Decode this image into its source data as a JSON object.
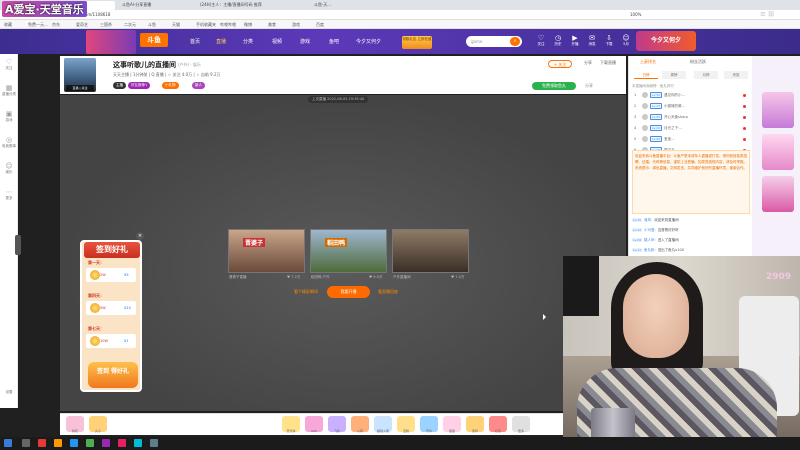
{
  "overlay_title": "A爱宝·天堂音乐",
  "browser": {
    "tabs": [
      "斗鱼(TV)-分享...",
      "斗鱼Al-分享直播",
      "(24H)主人：主播/直播间号码 推荐",
      "斗鱼·天..."
    ],
    "url": "http://www.douyu.com/1108618",
    "bookmarks": [
      "收藏",
      "免费一元...",
      "京东",
      "爱奇艺",
      "三国杀",
      "二次元",
      "斗鱼",
      "天猫",
      "手机收藏夹",
      "哔哩哔哩",
      "微博",
      "美食",
      "游戏",
      "百度"
    ],
    "zoom": "100%"
  },
  "site": {
    "logo": "斗鱼",
    "nav": [
      "首页",
      "直播",
      "分类",
      "视频",
      "游戏",
      "鱼吧",
      "今夕又何夕"
    ],
    "promo": "领取礼包 立即充值",
    "search_placeholder": "game",
    "header_icons": [
      "关注",
      "历史",
      "开播",
      "消息",
      "下载",
      "5月"
    ],
    "banner_text": "今夕又何夕"
  },
  "left_sidebar": [
    "关注",
    "直播分类",
    "游戏",
    "电竞赛事",
    "娱乐",
    "更多"
  ],
  "left_sidebar_bottom": "设置",
  "room": {
    "title": "这事听歌儿的直播间",
    "sub": "(户外) · 娱乐",
    "line2": "天天主播  |  1分钟前  |  Q 直播  |  ☆ 关注 4.0万  |  ☆ 自助 9.2万",
    "tags": [
      "主播",
      "好友推荐1",
      "小礼物",
      "新人"
    ],
    "follow": "+ 关注",
    "actions": [
      "分享",
      "下载直播"
    ],
    "green_btn": "免费领取鱼丸",
    "share": "分享"
  },
  "player": {
    "last_live": "上次直播 2022-08-05 19:35:40",
    "recs": [
      {
        "badge": "晋婆子",
        "caption": "晋婆子直播"
      },
      {
        "badge": "稻田鸭",
        "caption": "稻田鸭 户外"
      },
      {
        "badge": "",
        "caption": "户外直播间"
      }
    ],
    "rec_meta": [
      "♥ 7.2万",
      "♥ 9.0万",
      "♥ 7.0万"
    ],
    "links": [
      "看个精彩瞬间",
      "看直播回放"
    ],
    "main_btn": "我要开播"
  },
  "signin": {
    "title": "签到好礼",
    "days": [
      "第一天：",
      "第四天：",
      "第七天："
    ],
    "rewards": [
      {
        "amount": "2W",
        "mult": "X5"
      },
      {
        "amount": "5W",
        "mult": "X10"
      },
      {
        "amount": "10W",
        "mult": "X1"
      }
    ],
    "button": "签到 得好礼",
    "close": "×"
  },
  "gifts": [
    "鲜花",
    "丸子",
    "荧光棒",
    "666",
    "飞机",
    "火箭",
    "超级火箭",
    "宝箱",
    "守护",
    "星星",
    "奖杯",
    "红包",
    "更多"
  ],
  "chat": {
    "tabs": [
      "土豪排名",
      "粉丝活跃"
    ],
    "subtabs": [
      "日榜",
      "周榜",
      "月榜",
      "贵族"
    ],
    "rank_header": "本直播间贡献榜 · 鱼丸排行",
    "ranks": [
      {
        "n": "1",
        "lv": "Lv.32",
        "name": "遇见你的小..."
      },
      {
        "n": "2",
        "lv": "Lv.27",
        "name": "小猫咪的窝..."
      },
      {
        "n": "3",
        "lv": "Lv.25",
        "name": "开心天使sharp"
      },
      {
        "n": "4",
        "lv": "Lv.22",
        "name": "月光之下·..."
      },
      {
        "n": "5",
        "lv": "Lv.20",
        "name": "宝宝..."
      },
      {
        "n": "6",
        "lv": "Lv.18",
        "name": "星空下..."
      }
    ],
    "notice": "欢迎来到斗鱼直播平台！斗鱼严禁未成年人直播或打赏，请勿轻信各类招聘、征婚、代练等信息，谨防上当受骗。如发现违规内容，请及时举报。系统提示：绿色直播，文明发言，共同维护良好的直播环境，谢谢合作。",
    "messages": [
      {
        "lv": "Lv.15",
        "name": "清风:",
        "text": "欢迎来到直播间"
      },
      {
        "lv": "Lv.12",
        "name": "小可爱:",
        "text": "这首歌好好听"
      },
      {
        "lv": "Lv.09",
        "name": "路人甲:",
        "text": "进入了直播间"
      },
      {
        "lv": "Lv.11",
        "name": "鱼丸粉:",
        "text": "送出了鱼丸x100"
      }
    ]
  },
  "webcam": {
    "number": "2909"
  },
  "colors": {
    "accent": "#ff7200",
    "header": "#4a33a4",
    "player_bg": "#4a4a4a"
  }
}
